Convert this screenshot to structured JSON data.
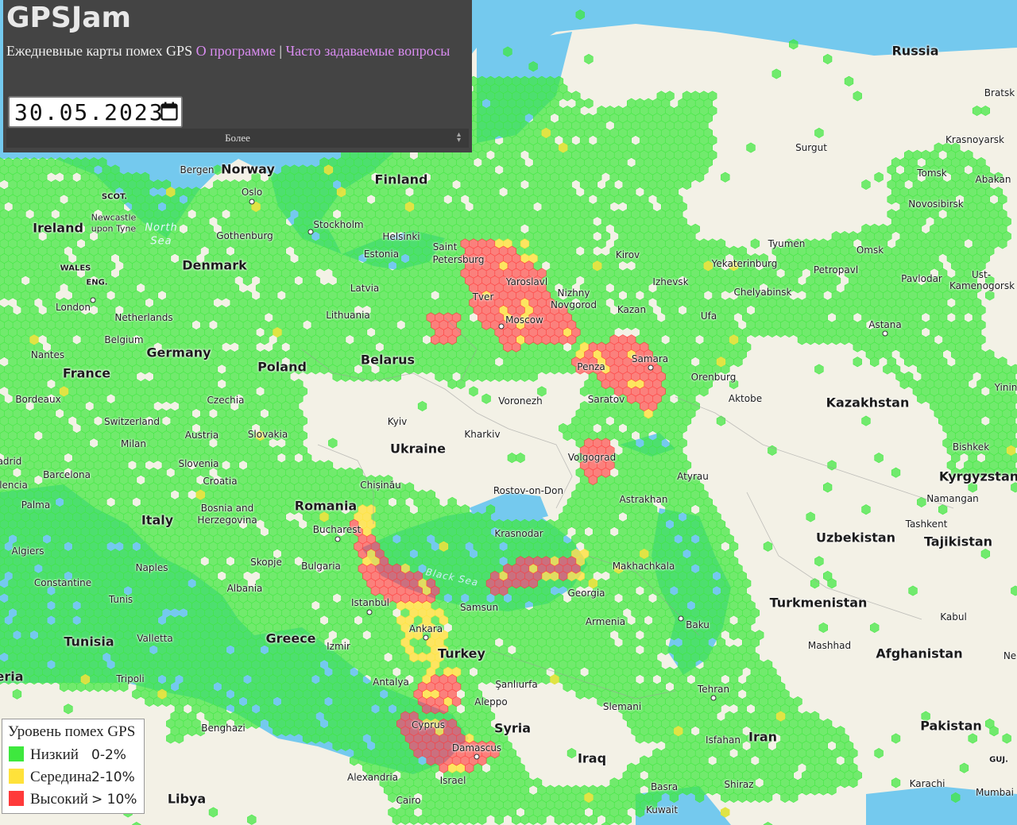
{
  "app": {
    "title": "GPSJam",
    "subtitle_text": "Ежедневные карты помех GPS",
    "link_about": "О программе",
    "separator": "|",
    "link_faq": "Часто задаваемые вопросы",
    "date_value": "30.05.2023",
    "more_label": "Более"
  },
  "legend": {
    "title": "Уровень помех GPS",
    "items": [
      {
        "label": "Низкий",
        "range": "0-2%",
        "color": "#3ee83e"
      },
      {
        "label": "Середина",
        "range": "2-10%",
        "color": "#ffe23a"
      },
      {
        "label": "Высокий",
        "range": "> 10%",
        "color": "#ff3a3a"
      }
    ]
  },
  "colors": {
    "low": "#3ee83e",
    "medium": "#ffe23a",
    "high": "#ff3a3a",
    "water": "#74c9ee",
    "land": "#f3f1e6",
    "panel": "#444444"
  },
  "map_labels": {
    "countries": [
      "Russia",
      "Norway",
      "Finland",
      "Ireland",
      "Denmark",
      "Estonia",
      "Latvia",
      "Lithuania",
      "Belarus",
      "Poland",
      "Germany",
      "France",
      "Netherlands",
      "Belgium",
      "Czechia",
      "Slovakia",
      "Austria",
      "Switzerland",
      "Ukraine",
      "Slovenia",
      "Croatia",
      "Bosnia and",
      "Herzegovina",
      "Romania",
      "Italy",
      "Bulgaria",
      "Albania",
      "Greece",
      "Turkey",
      "Georgia",
      "Armenia",
      "Syria",
      "Iraq",
      "Iran",
      "Kazakhstan",
      "Uzbekistan",
      "Turkmenistan",
      "Afghanistan",
      "Pakistan",
      "Kyrgyzstan",
      "Tajikistan",
      "Tunisia",
      "Libya",
      "Cyprus",
      "Israel",
      "Kuwait",
      "SCOT.",
      "WALES",
      "ENG."
    ],
    "cities": [
      "Bergen",
      "Oslo",
      "Stockholm",
      "Helsinki",
      "Gothenburg",
      "Saint",
      "Petersburg",
      "Yaroslavl",
      "Tver",
      "Moscow",
      "Nizhny",
      "Novgorod",
      "Kazan",
      "Kirov",
      "Izhevsk",
      "Yekaterinburg",
      "Chelyabinsk",
      "Tyumen",
      "Omsk",
      "Surgut",
      "Krasnoyarsk",
      "Tomsk",
      "Novosibirsk",
      "Abakan",
      "Bratsk",
      "Petropavl",
      "Pavlodar",
      "Ust-",
      "Kamenogorsk",
      "Ufa",
      "Samara",
      "Penza",
      "Saratov",
      "Orenburg",
      "Aktobe",
      "Astana",
      "Voronezh",
      "Kharkiv",
      "Kyiv",
      "Volgograd",
      "Rostov-on-Don",
      "Astrakhan",
      "Atyrau",
      "Krasnodar",
      "Makhachkala",
      "Chișinău",
      "Bucharest",
      "Skopje",
      "Istanbul",
      "Ankara",
      "Samsun",
      "Izmir",
      "Antalya",
      "Şanlıurfa",
      "Aleppo",
      "Damascus",
      "Slemani",
      "Tehran",
      "Baku",
      "Mashhad",
      "Isfahan",
      "Shiraz",
      "Basra",
      "Kabul",
      "Bishkek",
      "Namangan",
      "Tashkent",
      "Karachi",
      "Mumbai",
      "London",
      "Nantes",
      "Bordeaux",
      "Milan",
      "Barcelona",
      "Palma",
      "Algiers",
      "Constantine",
      "Tunis",
      "Naples",
      "Valletta",
      "Tripoli",
      "Benghazi",
      "Alexandria",
      "Cairo",
      "Newcastle",
      "upon Tyne",
      "adrid",
      "lencia",
      "eria",
      "Ne",
      "Yinin",
      "GUJ."
    ],
    "seas": [
      "North",
      "Sea",
      "Black Sea"
    ]
  }
}
